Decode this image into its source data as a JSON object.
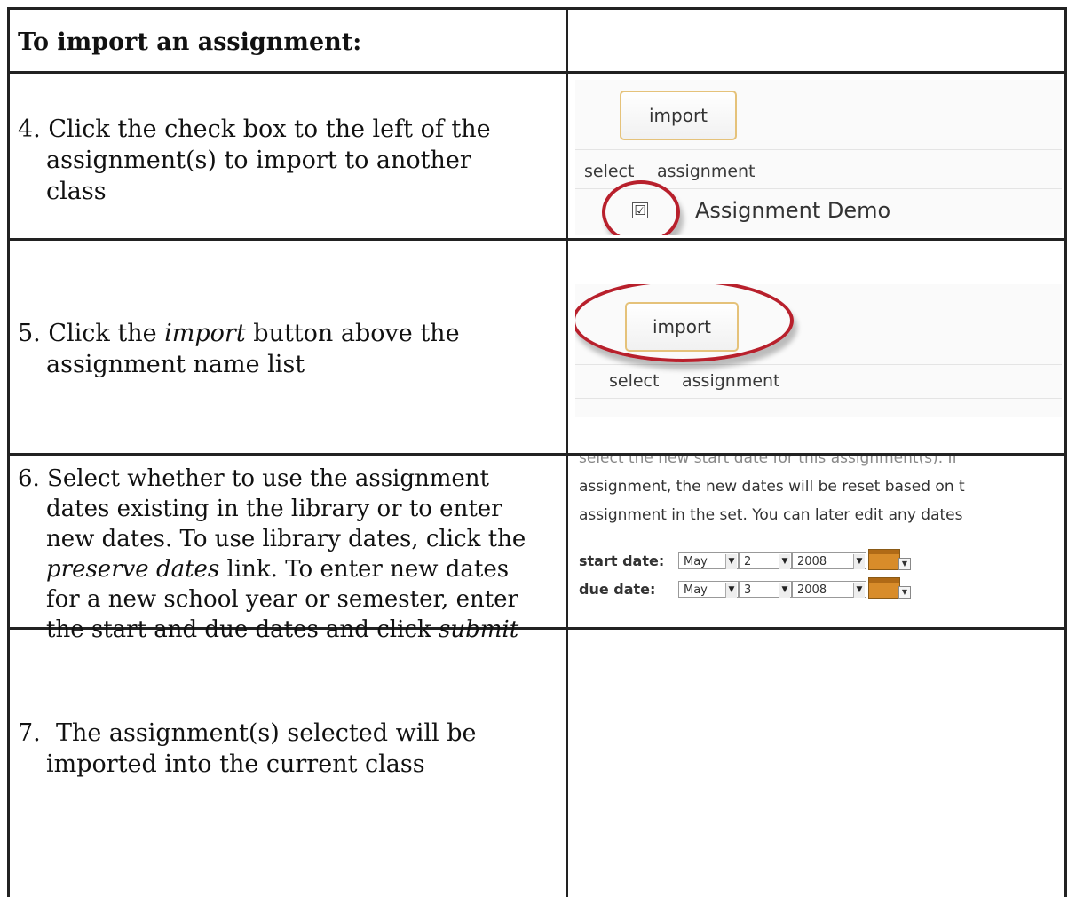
{
  "header": {
    "title": "To import an assignment:"
  },
  "steps": [
    {
      "number": "4.",
      "lines": [
        "Click the check box to the left of the",
        "assignment(s) to import to another",
        "class"
      ]
    },
    {
      "number": "5.",
      "prefix": "Click the ",
      "em": "import",
      "suffix": " button above the",
      "line2": "assignment name list"
    },
    {
      "number": "6.",
      "l1": "Select whether to use the assignment",
      "l2": "dates existing in the library or to enter",
      "l3": "new dates. To use library dates, click the",
      "l4_em": "preserve dates",
      "l4_suffix": " link. To enter new dates",
      "l5": "for a new school year or semester, enter",
      "l6_prefix": "the start and due dates and click ",
      "l6_em": "submit"
    },
    {
      "number": "7.",
      "lines": [
        "The assignment(s) selected will be",
        "imported into the current class"
      ]
    }
  ],
  "shot1": {
    "import_label": "import",
    "col_select": "select",
    "col_assignment": "assignment",
    "row_name": "Assignment Demo",
    "checked_glyph": "☑"
  },
  "shot2": {
    "import_label": "import",
    "col_select": "select",
    "col_assignment": "assignment"
  },
  "shot3": {
    "line0": "select the new start date for this assignment(s). If",
    "line1": "assignment, the new dates will be reset based on t",
    "line2": "assignment in the set. You can later edit any dates",
    "start_label": "start date:",
    "due_label": "due date:",
    "start": {
      "month": "May",
      "day": "2",
      "year": "2008"
    },
    "due": {
      "month": "May",
      "day": "3",
      "year": "2008"
    }
  },
  "colors": {
    "highlight": "#b8202c",
    "button_border": "#e5c27a",
    "calendar": "#d88c2a"
  }
}
